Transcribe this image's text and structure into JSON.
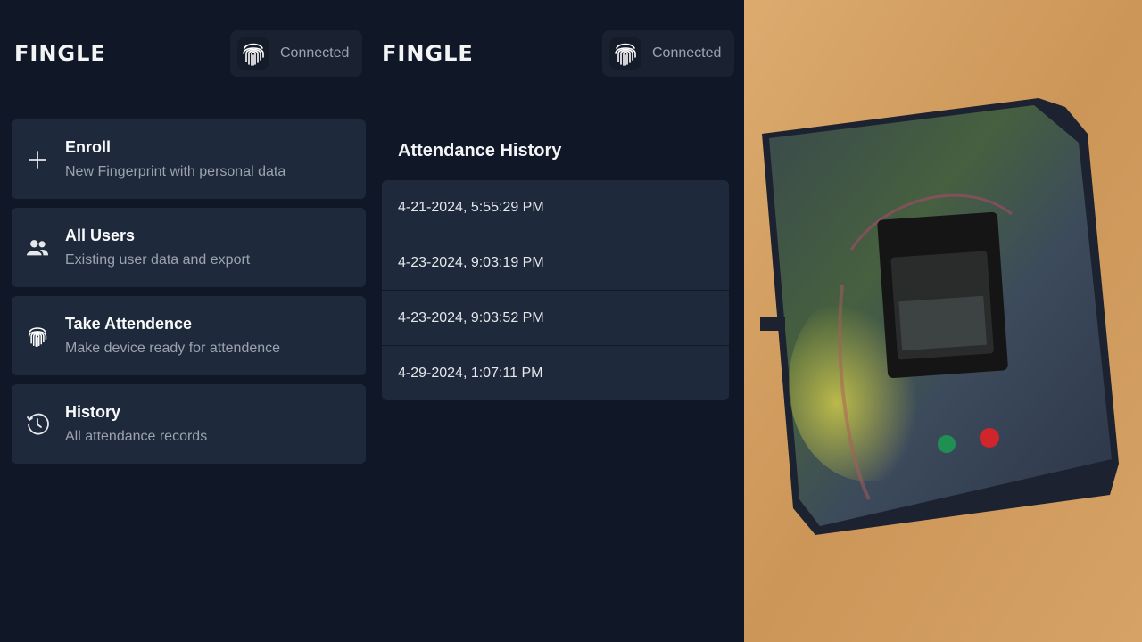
{
  "left_screen": {
    "brand": "FINGLE",
    "status": {
      "icon": "fingerprint-icon",
      "label": "Connected"
    },
    "menu": [
      {
        "icon": "plus-icon",
        "title": "Enroll",
        "subtitle": "New Fingerprint with personal data"
      },
      {
        "icon": "users-icon",
        "title": "All Users",
        "subtitle": "Existing user data and export"
      },
      {
        "icon": "fingerprint-icon",
        "title": "Take Attendence",
        "subtitle": "Make device ready for attendence"
      },
      {
        "icon": "clock-icon",
        "title": "History",
        "subtitle": "All attendance records"
      }
    ]
  },
  "right_screen": {
    "brand": "FINGLE",
    "status": {
      "icon": "fingerprint-icon",
      "label": "Connected"
    },
    "history": {
      "title": "Attendance History",
      "records": [
        "4-21-2024, 5:55:29 PM",
        "4-23-2024, 9:03:19 PM",
        "4-23-2024, 9:03:52 PM",
        "4-29-2024, 1:07:11 PM"
      ]
    }
  },
  "colors": {
    "background": "#101827",
    "card": "#1e293b",
    "text_primary": "#f9fafb",
    "text_secondary": "#9ca3af"
  }
}
